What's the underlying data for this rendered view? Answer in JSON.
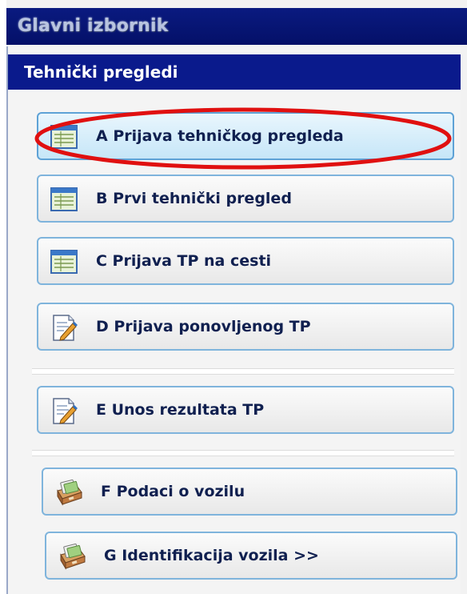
{
  "window": {
    "title": "Glavni izbornik"
  },
  "section": {
    "title": "Tehnički pregledi"
  },
  "menu": {
    "items": [
      {
        "label": "A Prijava tehničkog pregleda",
        "icon": "table-form-icon",
        "active": true
      },
      {
        "label": "B Prvi tehnički pregled",
        "icon": "table-form-icon",
        "active": false
      },
      {
        "label": "C Prijava TP na cesti",
        "icon": "table-form-icon",
        "active": false
      },
      {
        "label": "D Prijava ponovljenog TP",
        "icon": "document-pencil-icon",
        "active": false
      },
      {
        "label": "E Unos rezultata TP",
        "icon": "document-pencil-icon",
        "active": false
      },
      {
        "label": "F Podaci o vozilu",
        "icon": "card-file-box-icon",
        "active": false
      },
      {
        "label": "G Identifikacija vozila >>",
        "icon": "card-file-box-icon",
        "active": false
      }
    ]
  },
  "colors": {
    "title_bar": "#0a1a80",
    "section_header": "#0a1a8c",
    "button_border": "#7fb4dc",
    "active_button": "#c6e6f8",
    "highlight_ellipse": "#e01010"
  }
}
